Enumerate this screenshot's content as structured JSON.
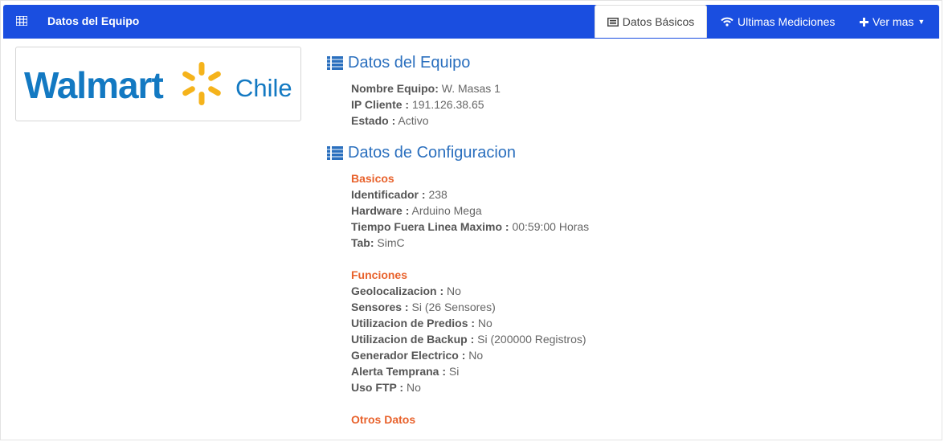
{
  "navbar": {
    "title": "Datos del Equipo",
    "tabs": [
      {
        "label": "Datos Básicos",
        "icon": "id-card-icon",
        "active": true
      },
      {
        "label": "Ultimas Mediciones",
        "icon": "wifi-icon",
        "active": false
      },
      {
        "label": "Ver mas",
        "icon": "plus-icon",
        "active": false
      }
    ]
  },
  "logo": {
    "brand": "Walmart",
    "region": "Chile",
    "brand_color": "#1379c2",
    "spark_color": "#f5b31b"
  },
  "equipo": {
    "title": "Datos del Equipo",
    "fields": [
      {
        "label": "Nombre Equipo:",
        "value": "W. Masas 1"
      },
      {
        "label": "IP Cliente :",
        "value": "191.126.38.65"
      },
      {
        "label": "Estado :",
        "value": "Activo"
      }
    ]
  },
  "configuracion": {
    "title": "Datos de Configuracion",
    "basicos": {
      "heading": "Basicos",
      "fields": [
        {
          "label": "Identificador :",
          "value": "238"
        },
        {
          "label": "Hardware :",
          "value": "Arduino Mega"
        },
        {
          "label": "Tiempo Fuera Linea Maximo :",
          "value": "00:59:00 Horas"
        },
        {
          "label": "Tab:",
          "value": "SimC"
        }
      ]
    },
    "funciones": {
      "heading": "Funciones",
      "fields": [
        {
          "label": "Geolocalizacion :",
          "value": "No"
        },
        {
          "label": "Sensores :",
          "value": "Si (26 Sensores)"
        },
        {
          "label": "Utilizacion de Predios :",
          "value": "No"
        },
        {
          "label": "Utilizacion de Backup :",
          "value": "Si (200000 Registros)"
        },
        {
          "label": "Generador Electrico :",
          "value": "No"
        },
        {
          "label": "Alerta Temprana :",
          "value": "Si"
        },
        {
          "label": "Uso FTP :",
          "value": "No"
        }
      ]
    },
    "otros": {
      "heading": "Otros Datos"
    }
  },
  "colors": {
    "navbar": "#1a4ee0",
    "section_title": "#2a6fbe",
    "subheading": "#e8622c"
  }
}
